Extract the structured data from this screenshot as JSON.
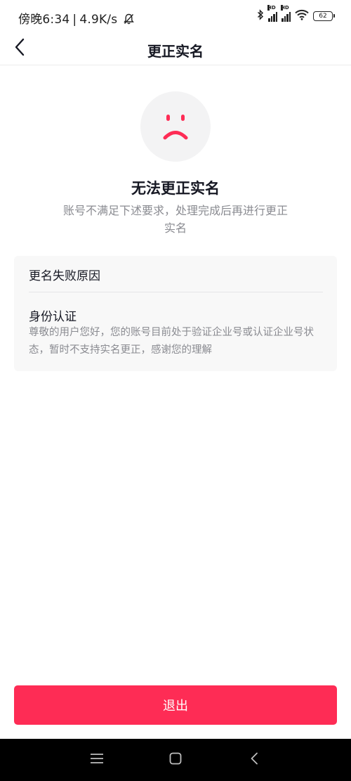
{
  "status_bar": {
    "time": "傍晚6:34",
    "net_speed": "4.9K/s",
    "hd_label": "HD",
    "battery": "62"
  },
  "header": {
    "title": "更正实名",
    "back_icon": "chevron-left-icon"
  },
  "result": {
    "icon": "sad-face-icon",
    "title": "无法更正实名",
    "description": "账号不满足下述要求，处理完成后再进行更正实名"
  },
  "failure_card": {
    "title": "更名失败原因",
    "reasons": [
      {
        "title": "身份认证",
        "description": "尊敬的用户您好，您的账号目前处于验证企业号或认证企业号状态，暂时不支持实名更正，感谢您的理解"
      }
    ]
  },
  "actions": {
    "exit_label": "退出"
  },
  "colors": {
    "accent": "#fe2c55",
    "title_text": "#161823",
    "secondary_text": "#8a8b91",
    "card_background": "#f8f8f8"
  },
  "system_nav": {
    "items": [
      "menu-icon",
      "home-icon",
      "back-icon"
    ]
  }
}
